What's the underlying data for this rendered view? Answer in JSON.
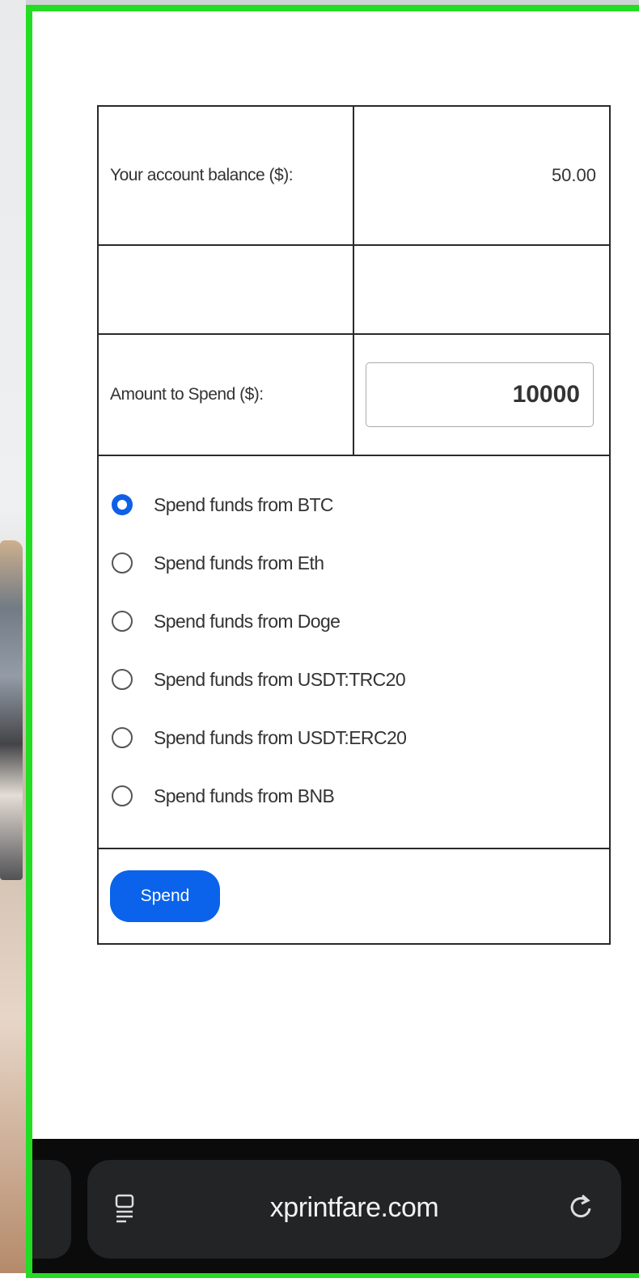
{
  "form": {
    "balance_label": "Your account balance ($):",
    "balance_value": "50.00",
    "amount_label": "Amount to Spend ($):",
    "amount_value": "10000",
    "options": [
      {
        "label": "Spend funds from BTC",
        "checked": true
      },
      {
        "label": "Spend funds from Eth",
        "checked": false
      },
      {
        "label": "Spend funds from Doge",
        "checked": false
      },
      {
        "label": "Spend funds from USDT:TRC20",
        "checked": false
      },
      {
        "label": "Spend funds from USDT:ERC20",
        "checked": false
      },
      {
        "label": "Spend funds from BNB",
        "checked": false
      }
    ],
    "spend_button": "Spend"
  },
  "browser": {
    "url": "xprintfare.com",
    "reader_icon": "reader-mode-icon",
    "reload_icon": "reload-icon"
  },
  "colors": {
    "highlight_border": "#22dd22",
    "accent": "#0a63ea"
  }
}
